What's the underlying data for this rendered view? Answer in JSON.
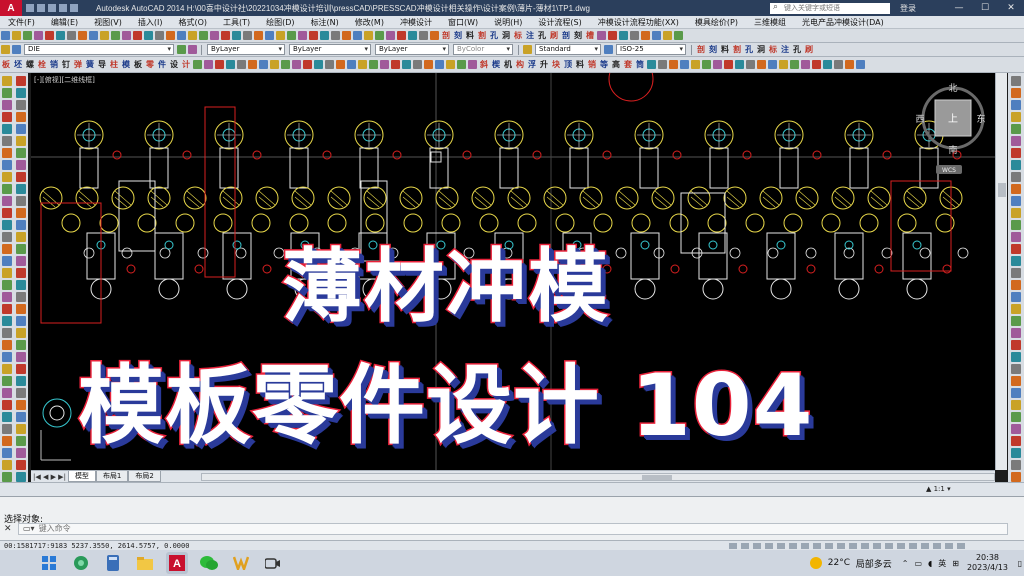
{
  "window": {
    "app_logo": "A",
    "title": "Autodesk AutoCAD 2014    H:\\00喜中设计社\\20221034冲模设计培训\\pressCAD\\PRESSCAD冲模设计相关操作\\设计案例\\薄片-薄材1\\TP1.dwg",
    "search_placeholder": "键入关键字或短语",
    "login": "登录"
  },
  "menu": [
    "文件(F)",
    "编辑(E)",
    "视图(V)",
    "插入(I)",
    "格式(O)",
    "工具(T)",
    "绘图(D)",
    "标注(N)",
    "修改(M)",
    "冲模设计",
    "窗口(W)",
    "说明(H)",
    "设计流程(S)",
    "冲模设计流程功能(XX)",
    "模具绘价(P)",
    "三维模组",
    "光电产品冲模设计(DA)"
  ],
  "toolbar": {
    "layer_combo": "DIE",
    "linetype1": "ByLayer",
    "linetype2": "ByLayer",
    "lineweight": "ByLayer",
    "plotstyle": "ByColor",
    "textstyle": "Standard",
    "dimstyle": "ISO-25",
    "cn_tools": [
      "剖",
      "刻",
      "料",
      "割",
      "孔",
      "洞",
      "标",
      "注",
      "孔",
      "刷",
      "剖",
      "刻",
      "槽"
    ],
    "cn_tools2": [
      "板",
      "坯",
      "螺",
      "栓",
      "销",
      "钉",
      "弹",
      "簧",
      "导",
      "柱",
      "模",
      "板",
      "零",
      "件",
      "设",
      "计"
    ],
    "cn_tools3": [
      "斜",
      "楔",
      "机",
      "构",
      "浮",
      "升",
      "块",
      "顶",
      "料",
      "销",
      "等",
      "高",
      "套",
      "筒"
    ]
  },
  "canvas": {
    "view_label": "[-][俯视][二维线框]",
    "viewcube": {
      "north": "北",
      "south": "南",
      "east": "东",
      "west": "西",
      "top": "上",
      "wcs": "WCS"
    }
  },
  "overlay": {
    "line1": "薄材冲模",
    "line2": "模板零件设计 104"
  },
  "tabs": {
    "nav": "|◀ ◀ ▶ ▶|",
    "items": [
      "模型",
      "布局1",
      "布局2"
    ]
  },
  "model_status": {
    "scale": "▲ 1:1 ▾"
  },
  "command": {
    "prompt": "选择对象:",
    "placeholder": "键入命令",
    "close": "✕"
  },
  "status": {
    "coords": "00:1581717:9183     5237.3550,  2614.5757, 0.0000"
  },
  "taskbar": {
    "weather_temp": "22°C",
    "weather_desc": "局部多云",
    "lang": "英",
    "time": "20:38",
    "date": "2023/4/13"
  },
  "colors": {
    "accent_red": "#e8223a",
    "shadow_blue": "#2a3a9a",
    "cad_yellow": "#e8d84a",
    "cad_red": "#d92020",
    "cad_cyan": "#37c8d0",
    "cad_white": "#e6e6e6"
  }
}
